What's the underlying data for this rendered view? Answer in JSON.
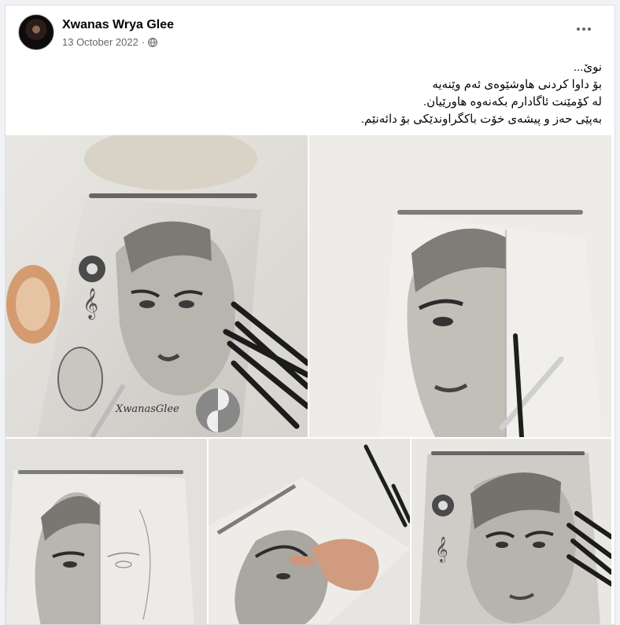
{
  "post": {
    "author": "Xwanas Wrya Glee",
    "date": "13 October 2022",
    "privacy_icon": "globe-icon",
    "more_icon": "more-options-icon",
    "caption_lines": [
      "نوێ...",
      "بۆ داوا کردنی هاوشێوەی ئەم وێنەیە",
      "لە کۆمێنت ئاگادارم بکەنەوە هاورێیان.",
      "بەپێی حەز و پیشەی خۆت باکگراوندێکی بۆ دائەنێم."
    ],
    "photos": [
      {
        "signature": "XwanasGlee"
      }
    ]
  }
}
